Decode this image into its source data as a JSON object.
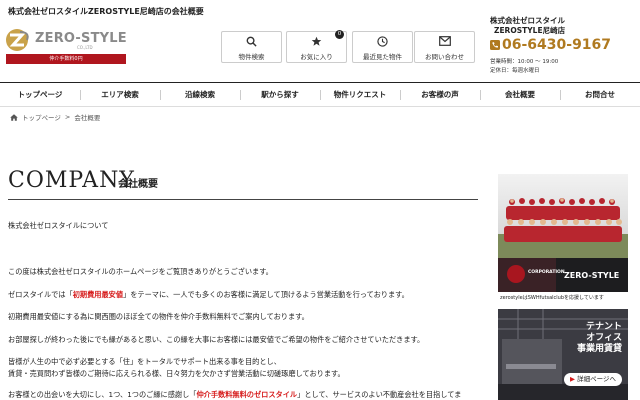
{
  "header": {
    "site_title": "株式会社ゼロスタイルZEROSTYLE尼崎店の会社概要",
    "logo_text": "ZERO-STYLE",
    "logo_sub": "CO.,LTD",
    "logo_tagline": "仲介手数料0円"
  },
  "quick_buttons": [
    {
      "label": "物件検索",
      "icon": "search-icon"
    },
    {
      "label": "お気に入り",
      "icon": "star-icon",
      "badge": "0"
    },
    {
      "label": "最近見た物件",
      "icon": "clock-icon"
    },
    {
      "label": "お問い合わせ",
      "icon": "mail-icon"
    }
  ],
  "contact": {
    "company": "株式会社ゼロスタイル",
    "store": "ZEROSTYLE尼崎店",
    "phone": "06-6430-9167",
    "hours": "営業時間：10:00 ～ 19:00",
    "closed": "定休日：毎週水曜日"
  },
  "nav": [
    "トップページ",
    "エリア検索",
    "沿線検索",
    "駅から探す",
    "物件リクエスト",
    "お客様の声",
    "会社概要",
    "お問合せ"
  ],
  "breadcrumb": {
    "home": "トップページ",
    "current": "会社概要"
  },
  "page": {
    "heading_en": "COMPANY",
    "heading_jp": "会社概要",
    "about": "株式会社ゼロスタイルについて",
    "p1": "この度は株式会社ゼロスタイルのホームページをご覧頂きありがとうございます。",
    "p2_a": "ゼロスタイルでは「",
    "p2_red": "初期費用最安値",
    "p2_b": "」をテーマに、一人でも多くのお客様に満足して頂けるよう営業活動を行っております。",
    "p3": "初期費用最安値にする為に関西圏のほぼ全ての物件を仲介手数料無料でご案内しております。",
    "p4": "お部屋探しが終わった後にでも縁があると思い、この縁を大事にお客様には最安値でご希望の物件をご紹介させていただきます。",
    "p5_1": "皆様が人生の中で必ず必要とする「住」をトータルでサポート出来る事を目的とし、",
    "p5_2": "賃貸・売買問わず皆様のご期待に応えられる様、日々努力を欠かさず営業活動に切磋琢磨しております。",
    "p6_a": "お客様との出会いを大切にし、1つ、1つのご縁に感謝し「",
    "p6_red": "仲介手数料無料のゼロスタイル",
    "p6_b": "」として、サービスのよい不動産会社を目指してま"
  },
  "banners": {
    "team": {
      "partner": "CORPORATION",
      "logo": "ZERO-STYLE",
      "caption": "zerostyleはSWHfutsalclubを応援しています"
    },
    "office": {
      "line1": "テナント",
      "line2": "オフィス",
      "line3": "事業用賃貸",
      "button": "詳細ページへ"
    }
  },
  "colors": {
    "accent_red": "#d61b1b",
    "phone_gold": "#b07a20",
    "tag_red": "#b0161e"
  }
}
